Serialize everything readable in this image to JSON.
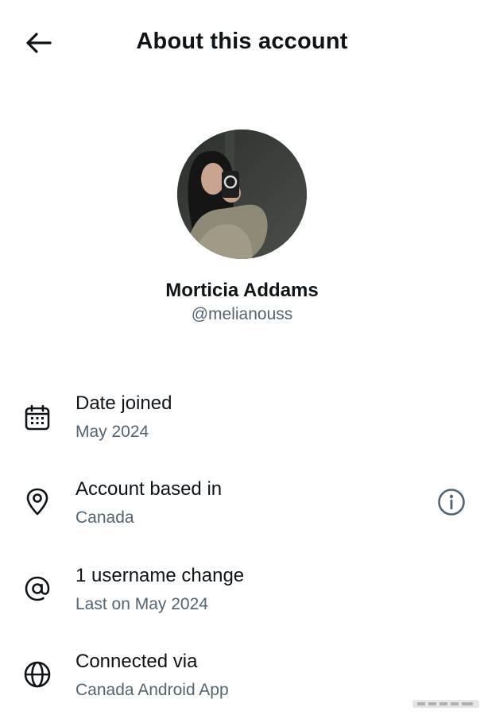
{
  "header": {
    "title": "About this account",
    "back_icon": "arrow-left-icon"
  },
  "profile": {
    "name": "Morticia Addams",
    "handle": "@melianouss",
    "avatar": "profile-photo"
  },
  "details": [
    {
      "icon": "calendar-icon",
      "title": "Date joined",
      "value": "May 2024"
    },
    {
      "icon": "location-pin-icon",
      "title": "Account based in",
      "value": "Canada",
      "action_icon": "info-icon"
    },
    {
      "icon": "at-sign-icon",
      "title": "1 username change",
      "value": "Last on May 2024"
    },
    {
      "icon": "globe-icon",
      "title": "Connected via",
      "value": "Canada Android App"
    }
  ],
  "colors": {
    "primary_text": "#0f1419",
    "secondary_text": "#536471",
    "background": "#ffffff"
  }
}
